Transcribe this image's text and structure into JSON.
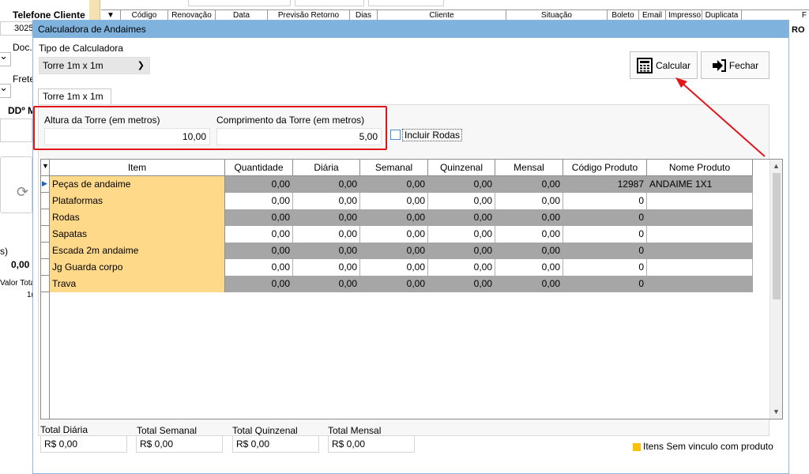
{
  "background": {
    "left_labels": {
      "phone_header": "Telefone Cliente",
      "phone_value": "3025",
      "doc": "Doc.",
      "frete": "Frete",
      "ddd": "DDº MF",
      "s_paren": "s)",
      "amount": "0,00",
      "valor_total": "Valor Tota",
      "valor_total_value": "1("
    },
    "grid_columns": [
      "Código",
      "Renovação",
      "Data",
      "Previsão Retorno",
      "Dias",
      "Cliente",
      "Situação",
      "Boleto",
      "Email",
      "Impresso",
      "Duplicata",
      "F"
    ],
    "right_fragment": "RO"
  },
  "dialog": {
    "title": "Calculadora de Andaimes",
    "calc_type_label": "Tipo de Calculadora",
    "calc_type_value": "Torre 1m x 1m",
    "calc_button": "Calcular",
    "close_button": "Fechar",
    "tab_label": "Torre 1m x 1m",
    "height_label": "Altura da Torre (em metros)",
    "height_value": "10,00",
    "length_label": "Comprimento da Torre (em metros)",
    "length_value": "5,00",
    "wheels_label": "Incluir Rodas",
    "wheels_checked": false
  },
  "grid": {
    "columns": [
      "Item",
      "Quantidade",
      "Diária",
      "Semanal",
      "Quinzenal",
      "Mensal",
      "Código Produto",
      "Nome Produto"
    ],
    "rows": [
      {
        "item": "Peças de andaime",
        "qtd": "0,00",
        "diaria": "0,00",
        "semanal": "0,00",
        "quinzenal": "0,00",
        "mensal": "0,00",
        "codigo": "12987",
        "nome": "ANDAIME 1X1"
      },
      {
        "item": "Plataformas",
        "qtd": "0,00",
        "diaria": "0,00",
        "semanal": "0,00",
        "quinzenal": "0,00",
        "mensal": "0,00",
        "codigo": "0",
        "nome": ""
      },
      {
        "item": "Rodas",
        "qtd": "0,00",
        "diaria": "0,00",
        "semanal": "0,00",
        "quinzenal": "0,00",
        "mensal": "0,00",
        "codigo": "0",
        "nome": ""
      },
      {
        "item": "Sapatas",
        "qtd": "0,00",
        "diaria": "0,00",
        "semanal": "0,00",
        "quinzenal": "0,00",
        "mensal": "0,00",
        "codigo": "0",
        "nome": ""
      },
      {
        "item": "Escada 2m andaime",
        "qtd": "0,00",
        "diaria": "0,00",
        "semanal": "0,00",
        "quinzenal": "0,00",
        "mensal": "0,00",
        "codigo": "0",
        "nome": ""
      },
      {
        "item": "Jg Guarda corpo",
        "qtd": "0,00",
        "diaria": "0,00",
        "semanal": "0,00",
        "quinzenal": "0,00",
        "mensal": "0,00",
        "codigo": "0",
        "nome": ""
      },
      {
        "item": "Trava",
        "qtd": "0,00",
        "diaria": "0,00",
        "semanal": "0,00",
        "quinzenal": "0,00",
        "mensal": "0,00",
        "codigo": "0",
        "nome": ""
      }
    ]
  },
  "totals": {
    "diaria_label": "Total Diária",
    "diaria_value": "R$ 0,00",
    "semanal_label": "Total Semanal",
    "semanal_value": "R$ 0,00",
    "quinzenal_label": "Total Quinzenal",
    "quinzenal_value": "R$ 0,00",
    "mensal_label": "Total Mensal",
    "mensal_value": "R$ 0,00"
  },
  "legend": {
    "text": "Itens Sem vinculo com produto",
    "color": "#ffc000"
  },
  "colors": {
    "title_bar": "#7fb2dd",
    "item_cell": "#ffd98a",
    "gray_row": "#a6a6a6",
    "highlight": "#e0161b"
  }
}
